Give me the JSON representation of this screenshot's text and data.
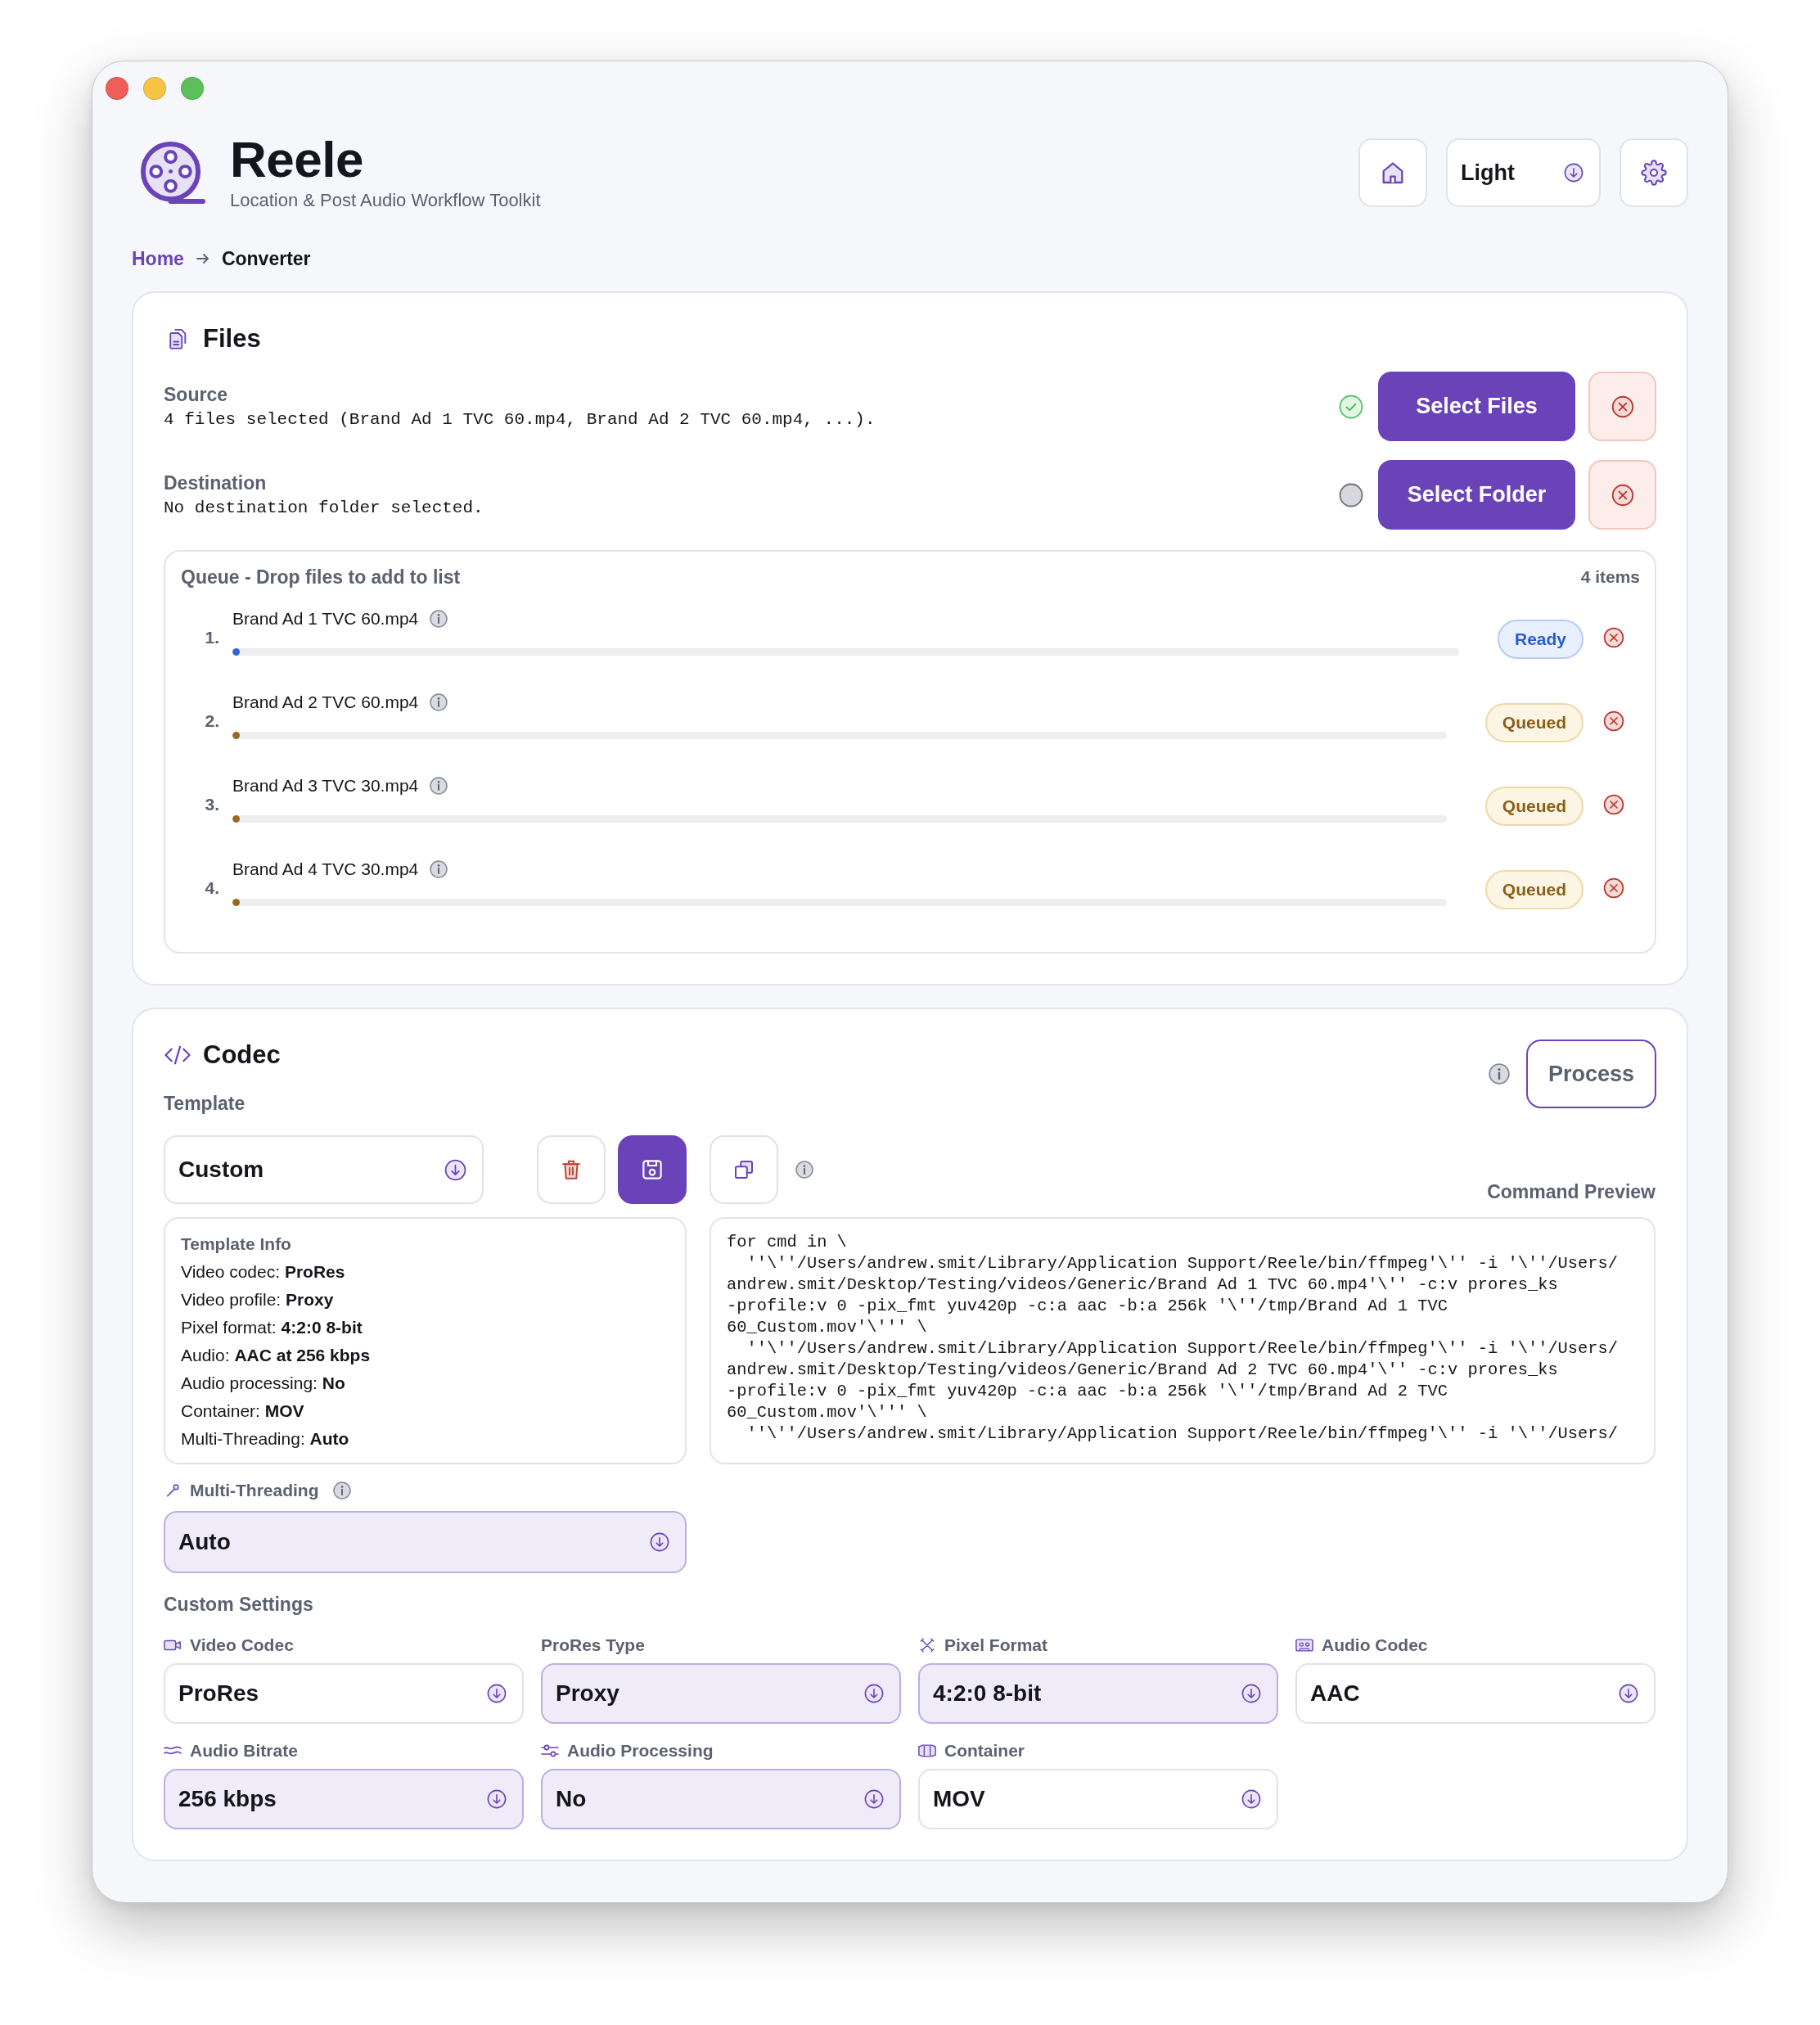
{
  "header": {
    "title": "Reele",
    "subtitle": "Location & Post Audio Workflow Toolkit",
    "theme": "Light"
  },
  "breadcrumb": [
    {
      "label": "Home",
      "kind": "link"
    },
    {
      "label": "Converter",
      "kind": "current"
    }
  ],
  "files": {
    "title": "Files",
    "rows": [
      {
        "label": "Source",
        "value": "4 files selected (Brand Ad 1 TVC 60.mp4, Brand Ad 2 TVC 60.mp4, ...).",
        "complete": true,
        "button": "Select Files"
      },
      {
        "label": "Destination",
        "value": "No destination folder selected.",
        "complete": false,
        "button": "Select Folder"
      }
    ],
    "queue": {
      "title": "Queue - Drop files to add to list",
      "count": "4 items",
      "items": [
        {
          "number": "1.",
          "name": "Brand Ad 1 TVC 60.mp4",
          "status": "Ready",
          "kind": "ready",
          "level": 0.005
        },
        {
          "number": "2.",
          "name": "Brand Ad 2 TVC 60.mp4",
          "status": "Queued",
          "kind": "queued",
          "level": 0.005
        },
        {
          "number": "3.",
          "name": "Brand Ad 3 TVC 30.mp4",
          "status": "Queued",
          "kind": "queued",
          "level": 0.005
        },
        {
          "number": "4.",
          "name": "Brand Ad 4 TVC 30.mp4",
          "status": "Queued",
          "kind": "queued",
          "level": 0.005
        }
      ]
    }
  },
  "codec": {
    "title": "Codec",
    "process_button": "Process",
    "template": {
      "label": "Template",
      "value": "Custom"
    },
    "template_info": {
      "title": "Template Info",
      "lines": [
        "Video codec: **ProRes**",
        "Video profile: **Proxy**",
        "Pixel format: **4:2:0 8-bit**",
        "Audio: **AAC at 256 kbps**",
        "Audio processing: **No**",
        "Container: **MOV**",
        "Multi-Threading: **Auto**"
      ]
    },
    "command_preview": {
      "label": "Command Preview",
      "lines": [
        "for cmd in \\",
        "  ''\\''/Users/andrew.smit/Library/Application Support/Reele/bin/ffmpeg'\\'' -i '\\''/Users/",
        "andrew.smit/Desktop/Testing/videos/Generic/Brand Ad 1 TVC 60.mp4'\\'' -c:v prores_ks",
        "-profile:v 0 -pix_fmt yuv420p -c:a aac -b:a 256k '\\''/tmp/Brand Ad 1 TVC",
        "60_Custom.mov'\\''' \\",
        "  ''\\''/Users/andrew.smit/Library/Application Support/Reele/bin/ffmpeg'\\'' -i '\\''/Users/",
        "andrew.smit/Desktop/Testing/videos/Generic/Brand Ad 2 TVC 60.mp4'\\'' -c:v prores_ks",
        "-profile:v 0 -pix_fmt yuv420p -c:a aac -b:a 256k '\\''/tmp/Brand Ad 2 TVC",
        "60_Custom.mov'\\''' \\",
        "  ''\\''/Users/andrew.smit/Library/Application Support/Reele/bin/ffmpeg'\\'' -i '\\''/Users/"
      ]
    },
    "multi_threading": {
      "label": "Multi-Threading",
      "value": "Auto",
      "highlighted": true
    },
    "custom_settings": {
      "title": "Custom Settings",
      "fields": [
        {
          "label": "Video Codec",
          "value": "ProRes",
          "highlighted": false
        },
        {
          "label": "ProRes Type",
          "value": "Proxy",
          "highlighted": true
        },
        {
          "label": "Pixel Format",
          "value": "4:2:0 8-bit",
          "highlighted": true
        },
        {
          "label": "Audio Codec",
          "value": "AAC",
          "highlighted": false
        },
        {
          "label": "Audio Bitrate",
          "value": "256 kbps",
          "highlighted": true
        },
        {
          "label": "Audio Processing",
          "value": "No",
          "highlighted": true
        },
        {
          "label": "Container",
          "value": "MOV",
          "highlighted": false
        }
      ]
    }
  }
}
